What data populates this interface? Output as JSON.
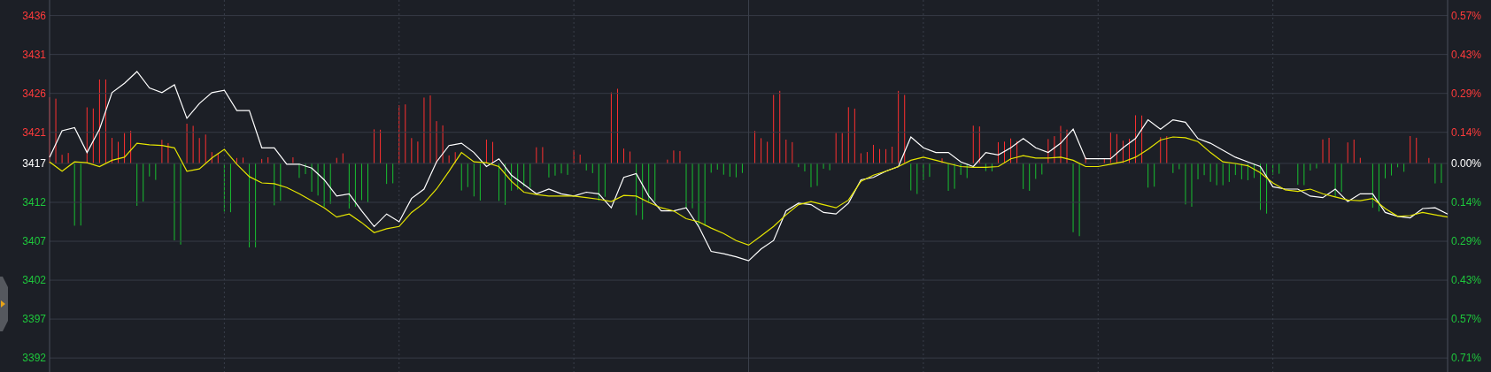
{
  "chart": {
    "chart_data": {
      "type": "line",
      "ylim": [
        3390.2,
        3438
      ],
      "grid": true,
      "categories": [
        null,
        null,
        null,
        null,
        null,
        null,
        null,
        null,
        null,
        null,
        null,
        null,
        null,
        null,
        null,
        null,
        null,
        null,
        null,
        null,
        null,
        null,
        null,
        null,
        null,
        null,
        null,
        null,
        null,
        null,
        null,
        null,
        null,
        null,
        null,
        null,
        null,
        null,
        null,
        null,
        null,
        null,
        null,
        null,
        null,
        null,
        null,
        null,
        null,
        null,
        null,
        null,
        null,
        null,
        null,
        null,
        null,
        null,
        null,
        null,
        null,
        null,
        null,
        null,
        null,
        null,
        null,
        null,
        null,
        null,
        null,
        null,
        null,
        null,
        null,
        null,
        null,
        null,
        null,
        null,
        null,
        null,
        null,
        null,
        null,
        null,
        null,
        null,
        null,
        null,
        null,
        null,
        null,
        null,
        null,
        null,
        null,
        null,
        null,
        null,
        null,
        null,
        null,
        null,
        null,
        null,
        null,
        null,
        null,
        null,
        null,
        null,
        null
      ],
      "yticks": [
        {
          "value": 3436,
          "label": "3436"
        },
        {
          "value": 3431,
          "label": "3431"
        },
        {
          "value": 3426,
          "label": "3426"
        },
        {
          "value": 3421,
          "label": "3421"
        },
        {
          "value": 3417,
          "label": "3417"
        },
        {
          "value": 3412,
          "label": "3412"
        },
        {
          "value": 3407,
          "label": "3407"
        },
        {
          "value": 3402,
          "label": "3402"
        },
        {
          "value": 3397,
          "label": "3397"
        },
        {
          "value": 3392,
          "label": "3392"
        }
      ],
      "series": [
        {
          "color": "#ffffff",
          "values": [
            3417.8,
            3421.2,
            3421.6,
            3418.4,
            3421.4,
            3426.1,
            3427.3,
            3428.8,
            3426.7,
            3426.1,
            3427.1,
            3422.8,
            3424.7,
            3426.1,
            3426.4,
            3423.8,
            3423.8,
            3419.0,
            3419.0,
            3416.9,
            3416.9,
            3416.4,
            3414.9,
            3412.8,
            3413.1,
            3410.9,
            3408.9,
            3410.5,
            3409.5,
            3412.5,
            3413.7,
            3417.2,
            3419.3,
            3419.6,
            3418.4,
            3416.6,
            3417.6,
            3415.5,
            3414.3,
            3413.1,
            3413.7,
            3413.1,
            3412.8,
            3413.3,
            3413.1,
            3411.3,
            3415.2,
            3415.7,
            3412.8,
            3410.9,
            3410.9,
            3411.3,
            3408.9,
            3405.7,
            3405.4,
            3405.0,
            3404.5,
            3406.0,
            3407.1,
            3410.9,
            3411.9,
            3411.7,
            3410.7,
            3410.5,
            3411.9,
            3414.9,
            3415.2,
            3416.0,
            3416.6,
            3420.4,
            3419.0,
            3418.4,
            3418.4,
            3417.2,
            3416.6,
            3418.4,
            3418.1,
            3419.0,
            3420.2,
            3419.0,
            3418.4,
            3419.6,
            3421.4,
            3417.6,
            3417.6,
            3417.6,
            3419.0,
            3420.2,
            3422.6,
            3421.4,
            3422.6,
            3422.3,
            3420.2,
            3419.6,
            3418.7,
            3417.8,
            3417.2,
            3416.6,
            3414.0,
            3413.7,
            3413.7,
            3412.8,
            3412.6,
            3413.7,
            3412.1,
            3413.1,
            3413.1,
            3410.7,
            3410.2,
            3410.0,
            3411.2,
            3411.3,
            3410.5
          ]
        },
        {
          "color": "#e6e600",
          "values": [
            3417.2,
            3416.0,
            3417.2,
            3417.1,
            3416.6,
            3417.4,
            3417.8,
            3419.6,
            3419.4,
            3419.3,
            3419.0,
            3416.0,
            3416.3,
            3417.7,
            3418.8,
            3416.9,
            3415.3,
            3414.5,
            3414.4,
            3413.9,
            3413.1,
            3412.2,
            3411.3,
            3410.1,
            3410.5,
            3409.4,
            3408.1,
            3408.6,
            3408.9,
            3410.7,
            3411.9,
            3413.7,
            3416.0,
            3418.4,
            3417.2,
            3417.1,
            3416.6,
            3414.7,
            3413.3,
            3413.0,
            3412.8,
            3412.8,
            3412.8,
            3412.6,
            3412.4,
            3412.1,
            3412.9,
            3412.8,
            3412.0,
            3411.3,
            3410.9,
            3409.9,
            3409.5,
            3408.7,
            3408.0,
            3407.1,
            3406.5,
            3407.7,
            3408.9,
            3410.4,
            3411.7,
            3412.1,
            3411.7,
            3411.3,
            3412.3,
            3414.7,
            3415.5,
            3416.0,
            3416.6,
            3417.4,
            3417.8,
            3417.4,
            3417.0,
            3416.6,
            3416.5,
            3416.5,
            3416.6,
            3417.6,
            3418.0,
            3417.7,
            3417.7,
            3417.8,
            3417.4,
            3416.6,
            3416.6,
            3416.9,
            3417.2,
            3417.8,
            3418.8,
            3420.0,
            3420.4,
            3420.3,
            3419.8,
            3418.4,
            3417.2,
            3417.0,
            3416.7,
            3415.8,
            3414.5,
            3413.6,
            3413.4,
            3413.7,
            3413.1,
            3412.7,
            3412.3,
            3412.2,
            3412.5,
            3411.2,
            3410.2,
            3410.3,
            3410.7,
            3410.4,
            3410.1
          ]
        }
      ]
    },
    "right_axis_labels": [
      "0.57%",
      "0.43%",
      "0.29%",
      "0.14%",
      "0.00%",
      "0.14%",
      "0.29%",
      "0.43%",
      "0.57%",
      "0.71%"
    ]
  }
}
